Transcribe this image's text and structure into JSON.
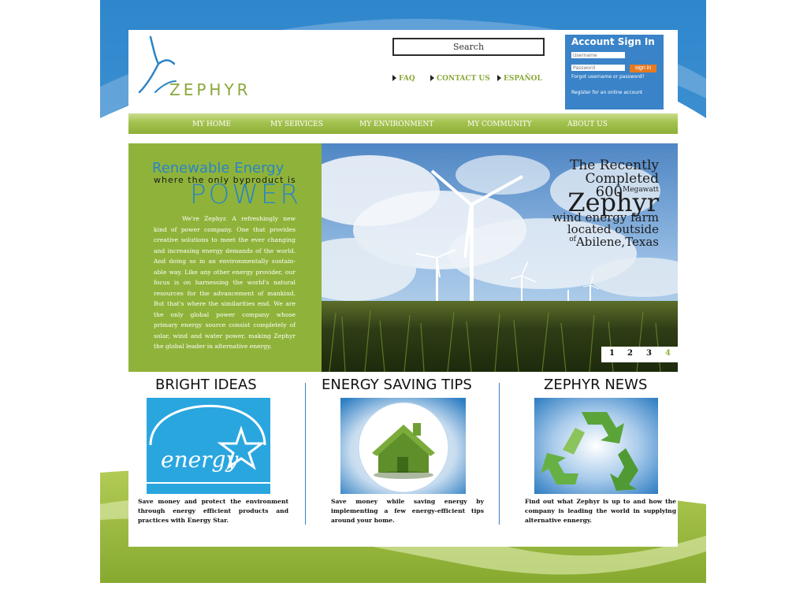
{
  "brand": {
    "name": "ZEPHYR"
  },
  "search": {
    "placeholder": "Search"
  },
  "top_links": [
    {
      "label": "FAQ"
    },
    {
      "label": "CONTACT US"
    },
    {
      "label": "ESPAÑOL"
    }
  ],
  "account": {
    "title": "Account Sign In",
    "username_placeholder": "Username",
    "password_placeholder": "Password",
    "signin_label": "sign in",
    "forgot_label": "Forgot username or password?",
    "register_label": "Register for an online account"
  },
  "nav": [
    {
      "label": "MY HOME"
    },
    {
      "label": "MY SERVICES"
    },
    {
      "label": "MY ENVIRONMENT"
    },
    {
      "label": "MY COMMUNITY"
    },
    {
      "label": "ABOUT US"
    }
  ],
  "intro": {
    "heading": "Renewable Energy",
    "subheading": "where the only byproduct is",
    "power": "POWER",
    "body": "We're Zephyr. A refreshingly new kind of power company. One that provides creative solutions to meet the ever changing and increasing energy demands of the world. And doing so in an environmentally sustain-able way. Like any other energy provider, our focus is on harnessing the world's natural resources for the advancement of mankind. But that's where the similarities end. We are the only global power company whose primary energy source consist completely of solar, wind and water power, making Zephyr the global leader in alternative energy."
  },
  "hero": {
    "line1": "The Recently",
    "line2": "Completed",
    "mw_number": "600",
    "mw_unit": "Megawatt",
    "name": "Zephyr",
    "line4": "wind energy farm",
    "line5": "located outside",
    "of": "of",
    "place": "Abilene,Texas",
    "pages": [
      "1",
      "2",
      "3",
      "4"
    ],
    "active_page": "4"
  },
  "columns": [
    {
      "title": "BRIGHT IDEAS",
      "image_text": "energy",
      "text": "Save money and protect the environment through energy efficient products and practices with Energy Star."
    },
    {
      "title": "ENERGY SAVING TIPS",
      "text": "Save money while saving energy by implementing a few energy-efficient tips around your home."
    },
    {
      "title": "ZEPHYR NEWS",
      "text": "Find out what Zephyr is up to and how the company is leading the world in supplying alternative ennergy."
    }
  ],
  "colors": {
    "blue": "#3a83c8",
    "green": "#8fb33a",
    "orange": "#e67a23"
  }
}
